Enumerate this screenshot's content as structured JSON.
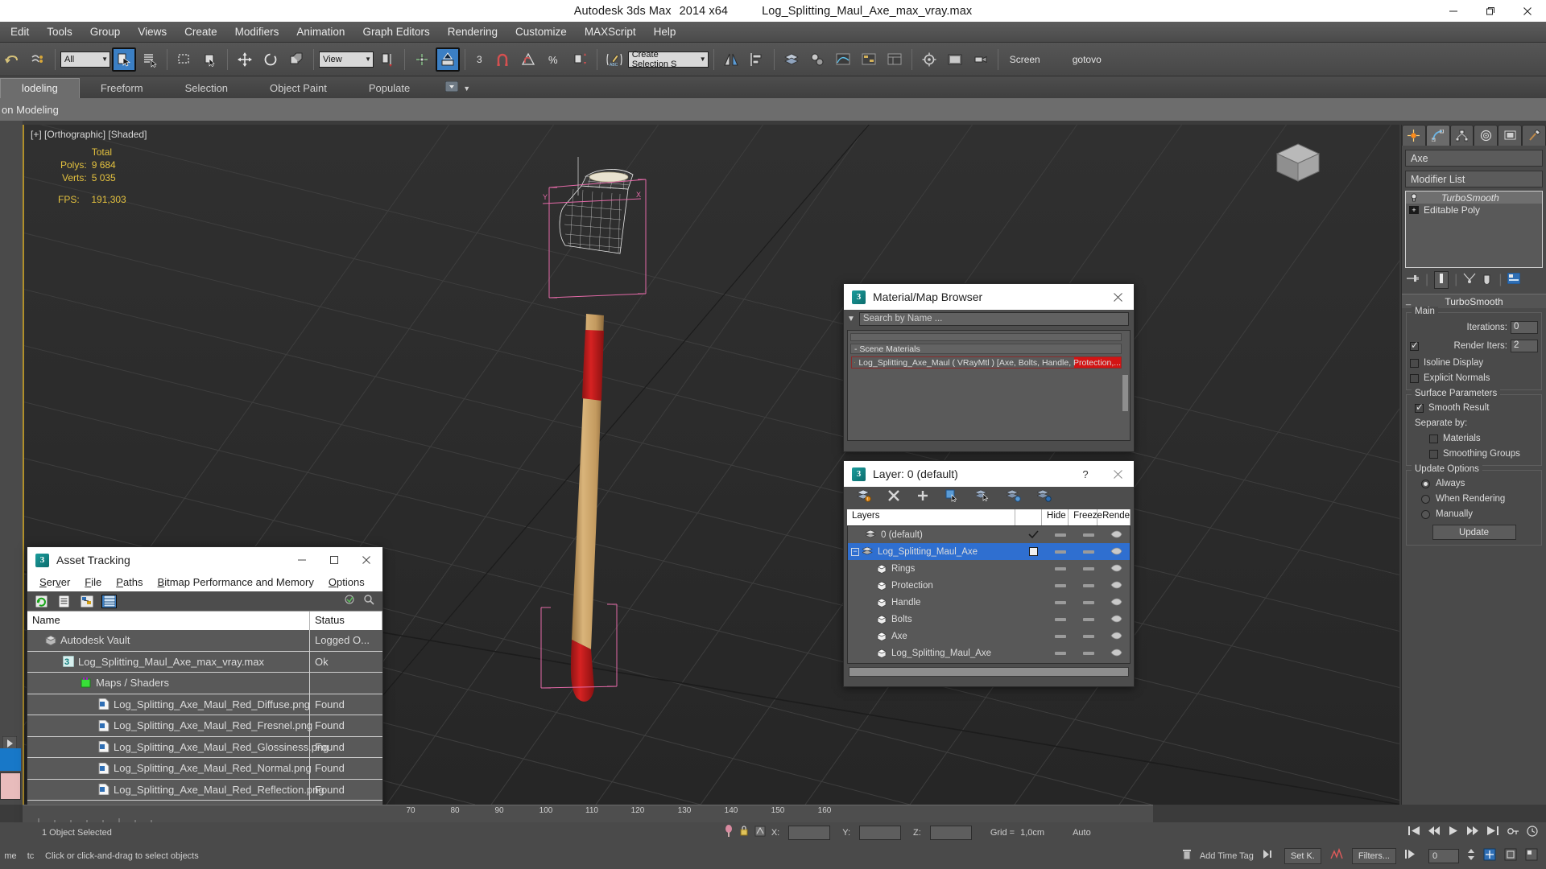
{
  "titlebar": {
    "app_name": "Autodesk 3ds Max",
    "version": "2014 x64",
    "file_name": "Log_Splitting_Maul_Axe_max_vray.max",
    "minimize": "—",
    "restore": "❐",
    "close": "✕"
  },
  "menubar": {
    "items": [
      {
        "label": "Edit"
      },
      {
        "label": "Tools"
      },
      {
        "label": "Group"
      },
      {
        "label": "Views"
      },
      {
        "label": "Create"
      },
      {
        "label": "Modifiers"
      },
      {
        "label": "Animation"
      },
      {
        "label": "Graph Editors"
      },
      {
        "label": "Rendering"
      },
      {
        "label": "Customize"
      },
      {
        "label": "MAXScript"
      },
      {
        "label": "Help"
      }
    ]
  },
  "toolbar": {
    "selection_filter": "All",
    "ref_coord_system": "View",
    "named_selection_set": "Create Selection S",
    "snap_count": "3",
    "screen_label": "Screen",
    "gotovo_label": "gotovo"
  },
  "ribbon": {
    "tabs": [
      {
        "label": "lodeling",
        "active": true
      },
      {
        "label": "Freeform",
        "active": false
      },
      {
        "label": "Selection",
        "active": false
      },
      {
        "label": "Object Paint",
        "active": false
      },
      {
        "label": "Populate",
        "active": false
      }
    ],
    "subbar_label": "on Modeling"
  },
  "viewport": {
    "label": "[+] [Orthographic] [Shaded]",
    "stats": {
      "header": "Total",
      "polys_label": "Polys:",
      "polys_value": "9 684",
      "verts_label": "Verts:",
      "verts_value": "5 035",
      "fps_label": "FPS:",
      "fps_value": "191,303"
    }
  },
  "command_panel": {
    "object_name": "Axe",
    "modifier_list_label": "Modifier List",
    "stack": [
      {
        "label": "TurboSmooth",
        "selected": true
      },
      {
        "label": "Editable Poly",
        "selected": false
      }
    ],
    "rollout_title": "TurboSmooth",
    "groups": {
      "main": {
        "label": "Main",
        "iterations_label": "Iterations:",
        "iterations_value": "0",
        "render_iters_label": "Render Iters:",
        "render_iters_value": "2",
        "render_iters_checked": true,
        "isoline_display_label": "Isoline Display",
        "isoline_display_checked": false,
        "explicit_normals_label": "Explicit Normals",
        "explicit_normals_checked": false
      },
      "surface": {
        "label": "Surface Parameters",
        "smooth_result_label": "Smooth Result",
        "smooth_result_checked": true,
        "separate_by_label": "Separate by:",
        "materials_label": "Materials",
        "materials_checked": false,
        "smoothing_groups_label": "Smoothing Groups",
        "smoothing_groups_checked": false
      },
      "update": {
        "label": "Update Options",
        "always_label": "Always",
        "when_rendering_label": "When Rendering",
        "manually_label": "Manually",
        "selected": "Always",
        "update_button": "Update"
      }
    }
  },
  "asset_tracking": {
    "title": "Asset Tracking",
    "minimize": "—",
    "maximize": "□",
    "close": "✕",
    "menus": [
      {
        "label": "Server"
      },
      {
        "label": "File"
      },
      {
        "label": "Paths"
      },
      {
        "label": "Bitmap Performance and Memory"
      },
      {
        "label": "Options"
      }
    ],
    "columns": [
      "Name",
      "Status"
    ],
    "rows": [
      {
        "name": "Autodesk Vault",
        "status": "Logged O...",
        "indent": 0,
        "icon": "vault-icon"
      },
      {
        "name": "Log_Splitting_Maul_Axe_max_vray.max",
        "status": "Ok",
        "indent": 1,
        "icon": "max-file-icon"
      },
      {
        "name": "Maps / Shaders",
        "status": "",
        "indent": 2,
        "icon": "maps-icon"
      },
      {
        "name": "Log_Splitting_Axe_Maul_Red_Diffuse.png",
        "status": "Found",
        "indent": 3,
        "icon": "png-icon"
      },
      {
        "name": "Log_Splitting_Axe_Maul_Red_Fresnel.png",
        "status": "Found",
        "indent": 3,
        "icon": "png-icon"
      },
      {
        "name": "Log_Splitting_Axe_Maul_Red_Glossiness.png",
        "status": "Found",
        "indent": 3,
        "icon": "png-icon"
      },
      {
        "name": "Log_Splitting_Axe_Maul_Red_Normal.png",
        "status": "Found",
        "indent": 3,
        "icon": "png-icon"
      },
      {
        "name": "Log_Splitting_Axe_Maul_Red_Reflection.png",
        "status": "Found",
        "indent": 3,
        "icon": "png-icon"
      }
    ]
  },
  "material_browser": {
    "title": "Material/Map Browser",
    "close": "✕",
    "search_placeholder": "Search by Name ...",
    "group_label": "- Scene Materials",
    "item_label": "Log_Splitting_Axe_Maul  ( VRayMtl ) [Axe, Bolts, Handle, Protection,...",
    "item_accent": "#d31414"
  },
  "layer_window": {
    "title": "Layer: 0 (default)",
    "help": "?",
    "close": "✕",
    "columns": [
      "Layers",
      "Hide",
      "Freeze",
      "Rende"
    ],
    "rows": [
      {
        "name": "0 (default)",
        "selected": false,
        "current": true,
        "indent": 1,
        "icon": "layer-icon"
      },
      {
        "name": "Log_Splitting_Maul_Axe",
        "selected": true,
        "current": false,
        "indent": 0,
        "icon": "layer-icon",
        "expandable": true
      },
      {
        "name": "Rings",
        "selected": false,
        "indent": 2,
        "icon": "object-icon"
      },
      {
        "name": "Protection",
        "selected": false,
        "indent": 2,
        "icon": "object-icon"
      },
      {
        "name": "Handle",
        "selected": false,
        "indent": 2,
        "icon": "object-icon"
      },
      {
        "name": "Bolts",
        "selected": false,
        "indent": 2,
        "icon": "object-icon"
      },
      {
        "name": "Axe",
        "selected": false,
        "indent": 2,
        "icon": "object-icon"
      },
      {
        "name": "Log_Splitting_Maul_Axe",
        "selected": false,
        "indent": 2,
        "icon": "object-icon"
      }
    ]
  },
  "timeline": {
    "ticks": [
      "70",
      "80",
      "90",
      "100",
      "110",
      "120",
      "130",
      "140",
      "150",
      "160"
    ]
  },
  "statusbar": {
    "selection_text": "1 Object Selected",
    "prompt_text": "Click or click-and-drag to select objects",
    "x_label": "X:",
    "y_label": "Y:",
    "z_label": "Z:",
    "grid_label": "Grid =",
    "grid_value": "1,0cm",
    "add_time_tag": "Add Time Tag",
    "set_key": "Set K.",
    "filters": "Filters...",
    "key_frame": "0",
    "auto_key": "Auto",
    "me_label": "me",
    "tc_label": "tc"
  },
  "colors": {
    "accent_blue": "#2f6fb5",
    "selection_blue": "#2f6fd0",
    "viewport_bg": "#2c2c2c",
    "panel_gray": "#4a4a4a",
    "stat_yellow": "#e3c13f",
    "gizmo_red": "#d31414"
  }
}
